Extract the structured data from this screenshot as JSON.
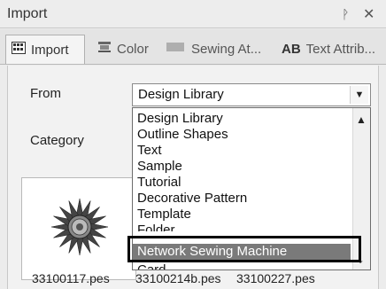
{
  "window": {
    "title": "Import",
    "pin_icon": "pin-icon",
    "close_icon": "close-icon"
  },
  "tabs": [
    {
      "label": "Import",
      "icon": "import-icon",
      "active": true
    },
    {
      "label": "Color",
      "icon": "color-icon"
    },
    {
      "label": "Sewing At...",
      "icon": "sewing-attributes-icon"
    },
    {
      "label": "Text Attrib...",
      "icon": "text-attributes-icon",
      "icon_text": "AB"
    }
  ],
  "form": {
    "from_label": "From",
    "from_value": "Design Library",
    "category_label": "Category"
  },
  "dropdown": {
    "options": [
      "Design Library",
      "Outline Shapes",
      "Text",
      "Sample",
      "Tutorial",
      "Decorative Pattern",
      "Template",
      "Folder",
      "Network Sewing Machine",
      "Card"
    ],
    "selected": "Network Sewing Machine"
  },
  "files": [
    "33100117.pes",
    "33100214b.pes",
    "33100227.pes"
  ]
}
